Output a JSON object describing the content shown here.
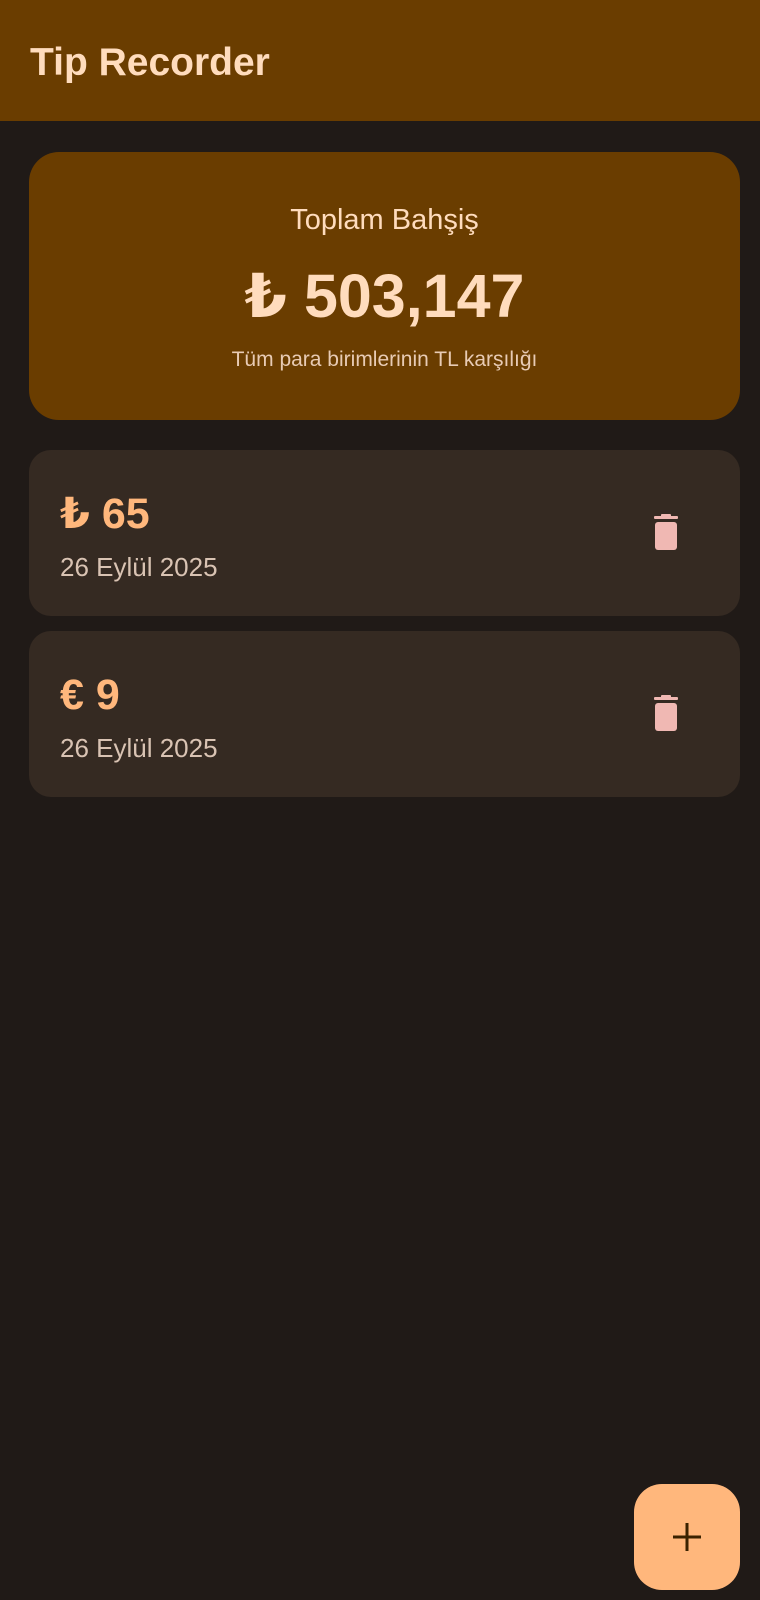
{
  "app_bar": {
    "title": "Tip Recorder"
  },
  "summary": {
    "label": "Toplam Bahşiş",
    "total": "₺ 503,147",
    "note": "Tüm para birimlerinin TL karşılığı"
  },
  "tips": [
    {
      "amount": "₺ 65",
      "date": "26 Eylül 2025",
      "icon": "delete-icon"
    },
    {
      "amount": "€ 9",
      "date": "26 Eylül 2025",
      "icon": "delete-icon"
    }
  ],
  "fab": {
    "icon": "add-icon",
    "label": "+"
  },
  "colors": {
    "app_bar": "#6a3d00",
    "background": "#201a17",
    "card": "#352a22",
    "accent": "#ffb77c",
    "delete_icon": "#f0b8b3",
    "title_text": "#ffdcbd"
  }
}
